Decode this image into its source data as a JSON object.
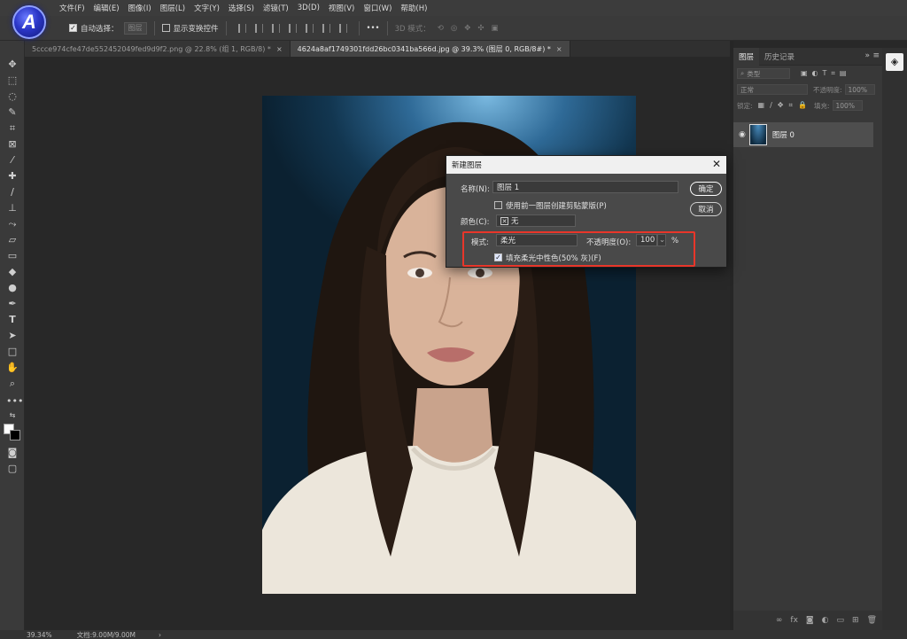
{
  "menu": {
    "items": [
      "文件(F)",
      "编辑(E)",
      "图像(I)",
      "图层(L)",
      "文字(Y)",
      "选择(S)",
      "滤镜(T)",
      "3D(D)",
      "视图(V)",
      "窗口(W)",
      "帮助(H)"
    ]
  },
  "logo_letter": "A",
  "options": {
    "auto_select_label": "自动选择：",
    "auto_select_target": "图层",
    "show_transform_label": "显示变换控件",
    "more": "•••",
    "mode3d_label": "3D 模式："
  },
  "tabs": [
    {
      "label": "5ccce974cfe47de552452049fed9d9f2.png @ 22.8% (组 1, RGB/8) *",
      "active": false
    },
    {
      "label": "4624a8af1749301fdd26bc0341ba566d.jpg @ 39.3% (图层 0, RGB/8#) *",
      "active": true
    }
  ],
  "tab_close": "×",
  "status": {
    "zoom": "39.34%",
    "doc": "文档:9.00M/9.00M",
    "arrow": "›"
  },
  "layers_panel": {
    "tab_layers": "图层",
    "tab_history": "历史记录",
    "filter_placeholder": "类型",
    "blend_mode": "正常",
    "opacity_label": "不透明度:",
    "opacity_value": "100%",
    "lock_label": "锁定:",
    "fill_label": "填充:",
    "fill_value": "100%",
    "layer_name": "图层 0",
    "expand_icon": "»",
    "menu_icon": "≡"
  },
  "dialog": {
    "title": "新建图层",
    "close": "✕",
    "name_label": "名称(N):",
    "name_value": "图层 1",
    "clip_label": "使用前一图层创建剪贴蒙版(P)",
    "color_label": "颜色(C):",
    "color_value": "无",
    "mode_label": "模式:",
    "mode_value": "柔光",
    "opacity_label": "不透明度(O):",
    "opacity_value": "100",
    "percent": "%",
    "fill_label": "填充柔光中性色(50% 灰)(F)",
    "ok": "确定",
    "cancel": "取消"
  },
  "colors": {
    "highlight": "#e8362a",
    "foreground": "#ffffff",
    "background": "#000000"
  }
}
